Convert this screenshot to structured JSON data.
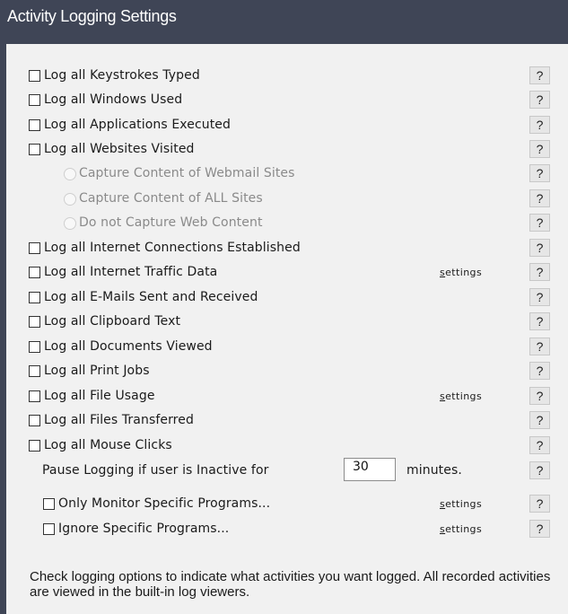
{
  "window": {
    "title": "Activity Logging Settings"
  },
  "help_label": "?",
  "settings_link": {
    "access_key": "s",
    "rest": "ettings"
  },
  "options": [
    {
      "id": "keystrokes",
      "label": "Log all Keystrokes Typed",
      "checked": false
    },
    {
      "id": "windows",
      "label": "Log all Windows Used",
      "checked": false
    },
    {
      "id": "applications",
      "label": "Log all Applications Executed",
      "checked": false
    },
    {
      "id": "websites",
      "label": "Log all Websites Visited",
      "checked": false
    },
    {
      "id": "capture-webmail",
      "label": "Capture Content of Webmail Sites",
      "type": "radio",
      "enabled": false,
      "selected": false
    },
    {
      "id": "capture-all",
      "label": "Capture Content of ALL Sites",
      "type": "radio",
      "enabled": false,
      "selected": false
    },
    {
      "id": "capture-none",
      "label": "Do not Capture Web Content",
      "type": "radio",
      "enabled": false,
      "selected": false
    },
    {
      "id": "internet-connections",
      "label": "Log all Internet Connections Established",
      "checked": false
    },
    {
      "id": "internet-traffic",
      "label": "Log all Internet Traffic Data",
      "checked": false,
      "has_settings": true
    },
    {
      "id": "emails",
      "label": "Log all E-Mails Sent and Received",
      "checked": false
    },
    {
      "id": "clipboard",
      "label": "Log all Clipboard Text",
      "checked": false
    },
    {
      "id": "documents",
      "label": "Log all Documents Viewed",
      "checked": false
    },
    {
      "id": "print-jobs",
      "label": "Log all Print Jobs",
      "checked": false
    },
    {
      "id": "file-usage",
      "label": "Log all File Usage",
      "checked": false,
      "has_settings": true
    },
    {
      "id": "files-transferred",
      "label": "Log all Files Transferred",
      "checked": false
    },
    {
      "id": "mouse-clicks",
      "label": "Log all Mouse Clicks",
      "checked": false
    }
  ],
  "inactivity": {
    "label": "Pause Logging if user is Inactive for",
    "value": "30",
    "unit": "minutes."
  },
  "program_filters": [
    {
      "id": "only-monitor",
      "label": "Only Monitor Specific Programs...",
      "checked": false,
      "has_settings": true
    },
    {
      "id": "ignore",
      "label": "Ignore Specific Programs...",
      "checked": false,
      "has_settings": true
    }
  ],
  "footer_text": "Check logging options to indicate what activities you want logged. All recorded activities are viewed in the built-in log viewers."
}
